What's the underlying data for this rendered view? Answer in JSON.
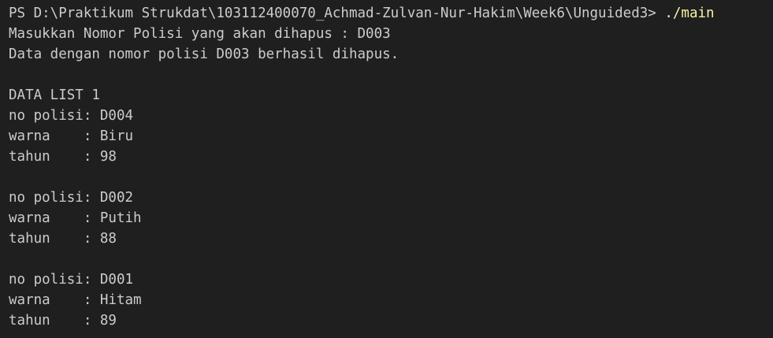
{
  "colors": {
    "background": "#1f1f1f",
    "text": "#cccccc",
    "command": "#f9f1a5"
  },
  "terminal": {
    "prompt": "PS D:\\Praktikum Strukdat\\103112400070_Achmad-Zulvan-Nur-Hakim\\Week6\\Unguided3> ",
    "command": "./main",
    "lines": [
      "Masukkan Nomor Polisi yang akan dihapus : D003",
      "Data dengan nomor polisi D003 berhasil dihapus.",
      "",
      "DATA LIST 1",
      "no polisi: D004",
      "warna    : Biru",
      "tahun    : 98",
      "",
      "no polisi: D002",
      "warna    : Putih",
      "tahun    : 88",
      "",
      "no polisi: D001",
      "warna    : Hitam",
      "tahun    : 89"
    ]
  }
}
